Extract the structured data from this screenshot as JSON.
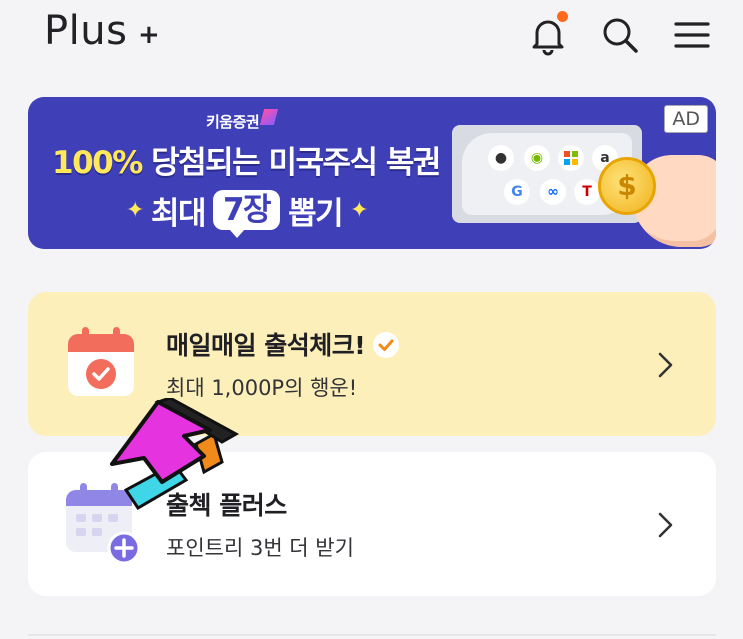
{
  "header": {
    "brand": "Plus",
    "brand_mark": "+",
    "icons": [
      "bell-icon",
      "search-icon",
      "menu-icon"
    ],
    "notification_dot_color": "#ff6a1a"
  },
  "ad_banner": {
    "badge": "AD",
    "sponsor": "키움증권",
    "headline_highlight": "100%",
    "headline_rest": " 당첨되는 미국주식 복권",
    "line2_prefix": "최대",
    "line2_count": "7장",
    "line2_suffix": "뽑기",
    "background_color": "#3f3fb8",
    "logo_letters": [
      "",
      "",
      "",
      "a",
      "G",
      "∞",
      "T"
    ]
  },
  "cards": [
    {
      "title": "매일매일 출석체크!",
      "subtitle": "최대 1,000P의 행운!",
      "icon": "calendar-check-icon",
      "background_color": "#fcefb9"
    },
    {
      "title": "출첵 플러스",
      "subtitle": "포인트리 3번 더 받기",
      "icon": "calendar-plus-icon",
      "background_color": "#ffffff"
    }
  ],
  "overlay": {
    "icon": "pointer-arrow-icon"
  }
}
